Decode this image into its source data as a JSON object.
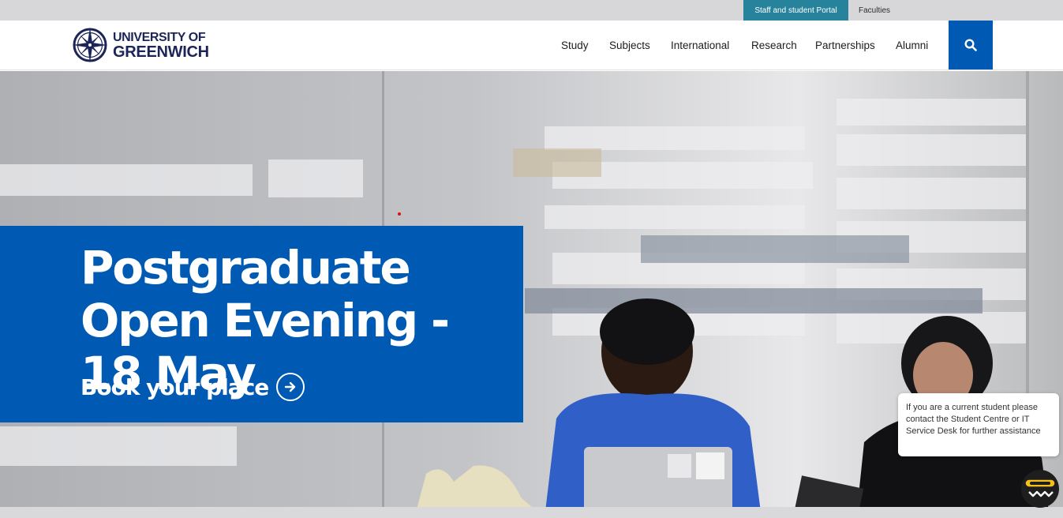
{
  "utility": {
    "portal_label": "Staff and student Portal",
    "faculties_label": "Faculties"
  },
  "brand": {
    "line1": "UNIVERSITY OF",
    "line2": "GREENWICH",
    "logo_icon": "compass-rose-icon"
  },
  "nav": {
    "items": [
      {
        "label": "Study"
      },
      {
        "label": "Subjects"
      },
      {
        "label": "International"
      },
      {
        "label": "Research"
      },
      {
        "label": "Partnerships"
      },
      {
        "label": "Alumni"
      }
    ],
    "search_icon": "search-icon"
  },
  "hero": {
    "title": "Postgraduate Open Evening - 18 May",
    "cta_label": "Book your place",
    "cta_icon": "arrow-right-circle-icon"
  },
  "chat": {
    "message": "If you are a current student please contact the Student Centre or IT Service Desk for further assistance",
    "launcher_icon": "chat-launcher-icon"
  },
  "colors": {
    "brand_blue": "#0059b3",
    "portal_teal": "#27839b",
    "navy": "#1c2557",
    "utility_bg": "#d7d7d9"
  }
}
